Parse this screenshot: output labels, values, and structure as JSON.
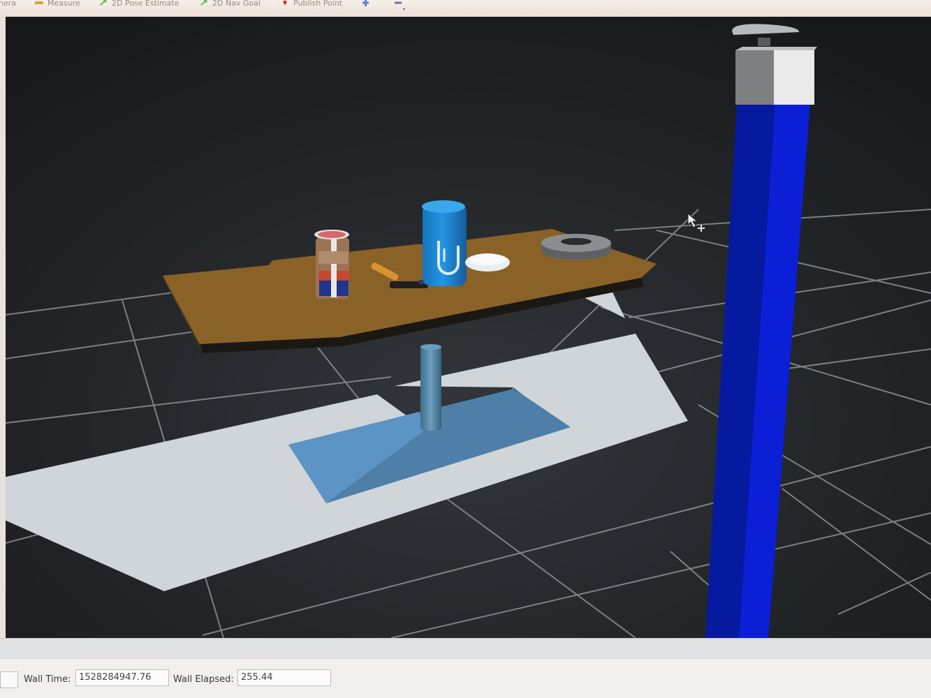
{
  "toolbar": {
    "tools": [
      {
        "name": "camera-tool",
        "label": "nera",
        "icon": "camera-icon"
      },
      {
        "name": "measure-tool",
        "label": "Measure",
        "icon": "ruler-icon",
        "color": "#d6a23a"
      },
      {
        "name": "pose-estimate-tool",
        "label": "2D Pose Estimate",
        "icon": "green-arrow-icon",
        "color": "#57c14a"
      },
      {
        "name": "nav-goal-tool",
        "label": "2D Nav Goal",
        "icon": "green-arrow-icon",
        "color": "#57c14a"
      },
      {
        "name": "publish-point-tool",
        "label": "Publish Point",
        "icon": "red-pin-icon",
        "color": "#d32b2b"
      },
      {
        "name": "add-tool",
        "label": "",
        "icon": "plus-icon",
        "color": "#5a7fd6"
      },
      {
        "name": "remove-tool",
        "label": "",
        "icon": "minus-icon",
        "color": "#7a6aa8"
      }
    ]
  },
  "viewport": {
    "description": "3D render view",
    "background": "#2c2e31",
    "accent_blue": "#0a1fd6",
    "table_color": "#8a6228",
    "can_color": "#1d86d2"
  },
  "statusbar": {
    "wall_time_label": "Wall Time:",
    "wall_time_value": "1528284947.76",
    "wall_elapsed_label": "Wall Elapsed:",
    "wall_elapsed_value": "255.44"
  }
}
